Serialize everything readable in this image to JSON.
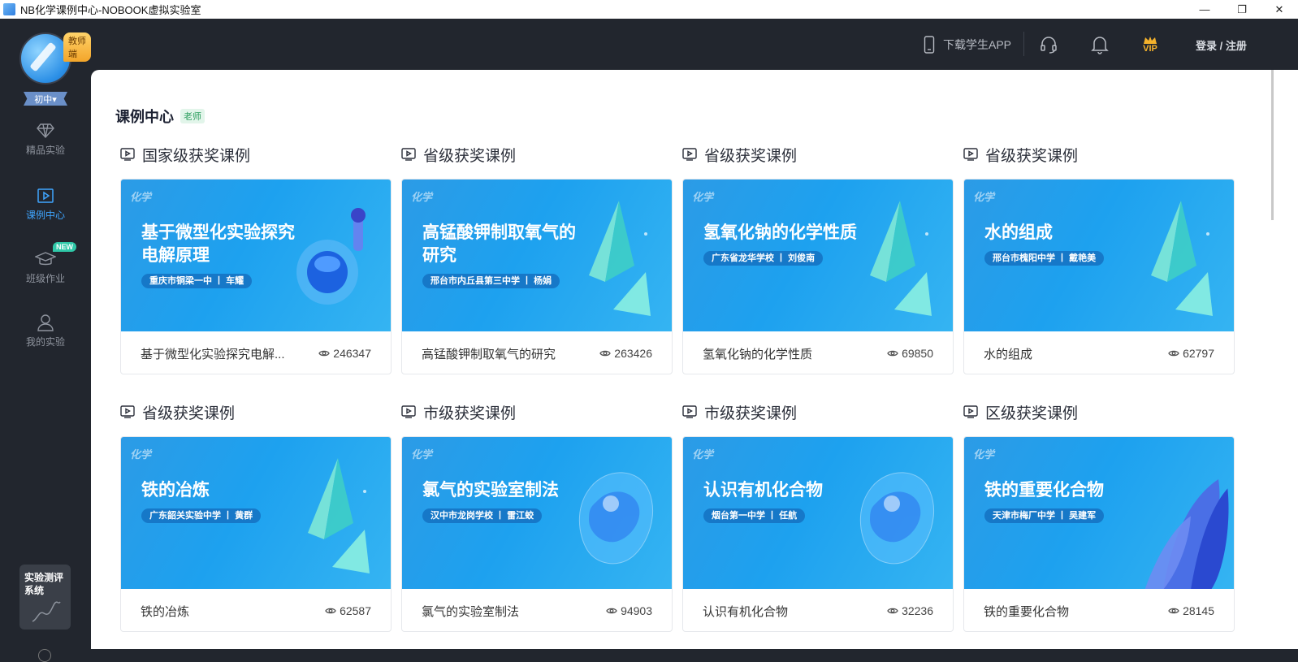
{
  "window": {
    "title": "NB化学课例中心-NOBOOK虚拟实验室",
    "controls": [
      "—",
      "❐",
      "✕"
    ]
  },
  "topbar": {
    "download_label": "下载学生APP",
    "vip_label": "VIP",
    "login_label": "登录 / 注册"
  },
  "sidebar": {
    "teacher_badge": "教师端",
    "grade_label": "初中▾",
    "items": [
      {
        "label": "精品实验",
        "icon": "diamond-icon"
      },
      {
        "label": "课例中心",
        "icon": "play-square-icon"
      },
      {
        "label": "班级作业",
        "icon": "graduation-cap-icon",
        "badge": "NEW"
      },
      {
        "label": "我的实验",
        "icon": "user-icon"
      }
    ],
    "eval_box_label": "实验测评系统"
  },
  "main": {
    "title": "课例中心",
    "title_tag": "老师",
    "cards": [
      {
        "category": "国家级获奖课例",
        "chem": "化学",
        "banner_title": "基于微型化实验探究电解原理",
        "school": "重庆市铜梁一中 丨 车耀",
        "name": "基于微型化实验探究电解...",
        "views": "246347",
        "deco": "flask"
      },
      {
        "category": "省级获奖课例",
        "chem": "化学",
        "banner_title": "高锰酸钾制取氧气的研究",
        "school": "邢台市内丘县第三中学 丨 杨娟",
        "name": "高锰酸钾制取氧气的研究",
        "views": "263426",
        "deco": "crystal"
      },
      {
        "category": "省级获奖课例",
        "chem": "化学",
        "banner_title": "氢氧化钠的化学性质",
        "school": "广东省龙华学校 丨 刘俊南",
        "name": "氢氧化钠的化学性质",
        "views": "69850",
        "deco": "crystal"
      },
      {
        "category": "省级获奖课例",
        "chem": "化学",
        "banner_title": "水的组成",
        "school": "邢台市槐阳中学 丨 戴艳美",
        "name": "水的组成",
        "views": "62797",
        "deco": "crystal"
      },
      {
        "category": "省级获奖课例",
        "chem": "化学",
        "banner_title": "铁的冶炼",
        "school": "广东韶关实验中学 丨 黄群",
        "name": "铁的冶炼",
        "views": "62587",
        "deco": "crystal"
      },
      {
        "category": "市级获奖课例",
        "chem": "化学",
        "banner_title": "氯气的实验室制法",
        "school": "汉中市龙岗学校 丨 雷江蛟",
        "name": "氯气的实验室制法",
        "views": "94903",
        "deco": "head"
      },
      {
        "category": "市级获奖课例",
        "chem": "化学",
        "banner_title": "认识有机化合物",
        "school": "烟台第一中学 丨 任航",
        "name": "认识有机化合物",
        "views": "32236",
        "deco": "head"
      },
      {
        "category": "区级获奖课例",
        "chem": "化学",
        "banner_title": "铁的重要化合物",
        "school": "天津市梅厂中学 丨 吴建军",
        "name": "铁的重要化合物",
        "views": "28145",
        "deco": "waves"
      }
    ]
  },
  "colors": {
    "sidebar_bg": "#22262e",
    "accent": "#3fa5ff",
    "banner_blue": "#1da1ef",
    "tag_green": "#2a9d5c"
  }
}
